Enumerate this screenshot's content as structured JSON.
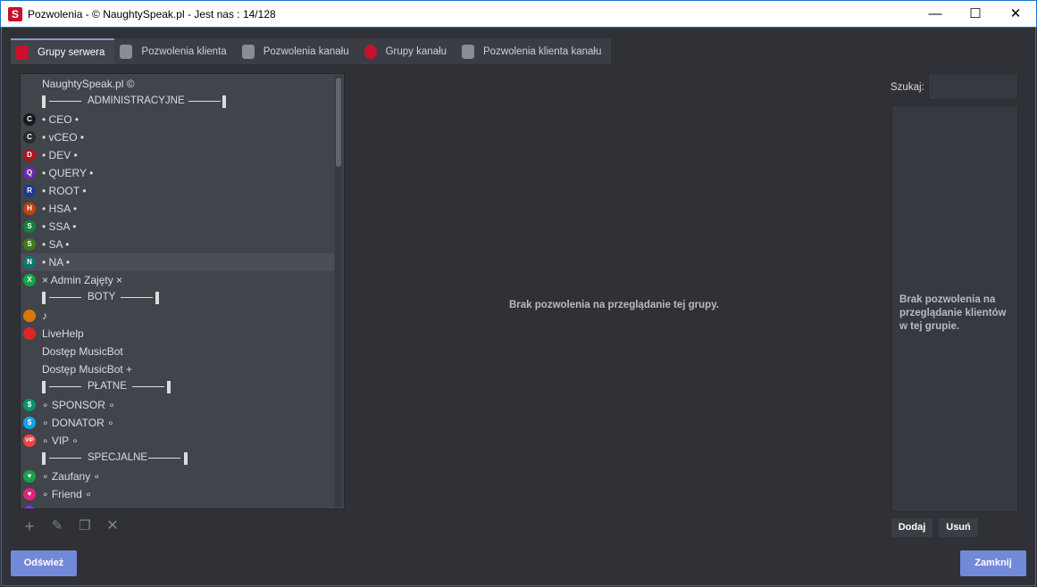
{
  "window": {
    "title": "Pozwolenia - © NaughtySpeak.pl - Jest nas : 14/128",
    "minimize": "—",
    "maximize": "☐",
    "close": "✕",
    "app_icon": "S"
  },
  "tabs": [
    {
      "label": "Grupy serwera"
    },
    {
      "label": "Pozwolenia klienta"
    },
    {
      "label": "Pozwolenia kanału"
    },
    {
      "label": "Grupy kanału"
    },
    {
      "label": "Pozwolenia klienta kanału"
    }
  ],
  "groups": {
    "header": "NaughtySpeak.pl ©",
    "sep_admin": "ADMINISTRACYJNE",
    "ceo": "• CEO •",
    "vceo": "• vCEO •",
    "dev": "• DEV •",
    "query": "• QUERY •",
    "root": "• ROOT •",
    "hsa": "• HSA •",
    "ssa": "• SSA •",
    "sa": "• SA •",
    "na": "• NA •",
    "admin_zajety": "× Admin Zajęty ×",
    "sep_boty": "BOTY",
    "music": "♪",
    "livehelp": "LiveHelp",
    "musicbot": "Dostęp MusicBot",
    "musicbot_plus": "Dostęp MusicBot +",
    "sep_platne": "PŁATNE",
    "sponsor": "∘ SPONSOR ∘",
    "donator": "∘ DONATOR ∘",
    "vip": "∘ VIP ∘",
    "sep_specjalne": "SPECJALNE",
    "zaufany": "∘ Zaufany ∘",
    "friend": "∘ Friend ∘"
  },
  "icons": {
    "ceo": "C",
    "vceo": "C",
    "dev": "D",
    "query": "Q",
    "root": "R",
    "hsa": "H",
    "ssa": "S",
    "sa": "S",
    "na": "N",
    "admin_zajety": "X",
    "sponsor": "$",
    "donator": "$",
    "vip": "VIP",
    "zaufany": "♥",
    "friend": "♥"
  },
  "colors": {
    "accent": "#7289da",
    "tab_active_border": "#8a93d8",
    "ceo": "#1a1a1a",
    "vceo": "#2a2a2a",
    "dev": "#b3121f",
    "query": "#6a2aa8",
    "root": "#1e3a8a",
    "hsa": "#c2410c",
    "ssa": "#15803d",
    "sa": "#3f7a1a",
    "na": "#0f766e",
    "admin_zajety": "#16a34a",
    "music": "#d97706",
    "livehelp": "#dc2626",
    "sponsor": "#059669",
    "donator": "#0ea5e9",
    "vip": "#ef4444",
    "zaufany": "#16a34a",
    "friend": "#db2777"
  },
  "toolbar": {
    "add_icon": "+",
    "edit_icon": "✎",
    "copy_icon": "❐",
    "delete_icon": "✕"
  },
  "center_message": "Brak pozwolenia na przeglądanie tej grupy.",
  "search": {
    "label": "Szukaj:",
    "value": ""
  },
  "clients_message": "Brak pozwolenia na przeglądanie klientów w tej grupie.",
  "buttons": {
    "add": "Dodaj",
    "remove": "Usuń",
    "refresh": "Odśwież",
    "close": "Zamknij"
  }
}
